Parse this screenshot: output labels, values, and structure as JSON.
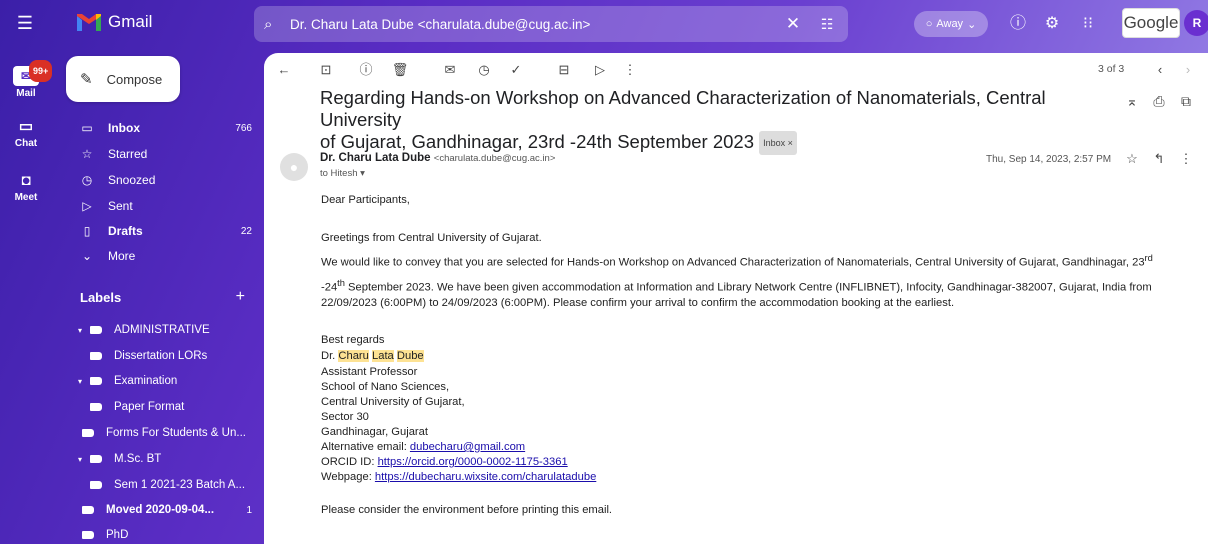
{
  "header": {
    "app_name": "Gmail",
    "search_value": "Dr. Charu Lata Dube <charulata.dube@cug.ac.in>",
    "status": "Away",
    "brand": "Google",
    "avatar_initial": "R"
  },
  "rail": {
    "mail_badge": "99+",
    "mail_label": "Mail",
    "chat_label": "Chat",
    "meet_label": "Meet"
  },
  "sidebar": {
    "compose": "Compose",
    "nav": [
      {
        "label": "Inbox",
        "count": "766"
      },
      {
        "label": "Starred",
        "count": ""
      },
      {
        "label": "Snoozed",
        "count": ""
      },
      {
        "label": "Sent",
        "count": ""
      },
      {
        "label": "Drafts",
        "count": "22"
      },
      {
        "label": "More",
        "count": ""
      }
    ],
    "labels_heading": "Labels",
    "labels": [
      {
        "label": "ADMINISTRATIVE",
        "count": ""
      },
      {
        "label": "Dissertation LORs",
        "count": ""
      },
      {
        "label": "Examination",
        "count": ""
      },
      {
        "label": "Paper Format",
        "count": ""
      },
      {
        "label": "Forms For Students & Un...",
        "count": ""
      },
      {
        "label": "M.Sc. BT",
        "count": ""
      },
      {
        "label": "Sem 1 2021-23 Batch A...",
        "count": ""
      },
      {
        "label": "Moved 2020-09-04...",
        "count": "1"
      },
      {
        "label": "PhD",
        "count": ""
      }
    ]
  },
  "message": {
    "pager": "3 of 3",
    "subject_line1": "Regarding Hands-on Workshop on Advanced Characterization of Nanomaterials, Central University",
    "subject_line2": "of Gujarat, Gandhinagar, 23rd -24th September 2023",
    "inbox_chip": "Inbox ×",
    "sender_name": "Dr. Charu Lata Dube",
    "sender_email": "<charulata.dube@cug.ac.in>",
    "to": "to Hitesh ▾",
    "date": "Thu, Sep 14, 2023, 2:57 PM",
    "greeting": "Dear Participants,",
    "line1": "Greetings from Central University of Gujarat.",
    "line2a": "We would like to convey that you are selected for Hands-on Workshop on Advanced Characterization of Nanomaterials, Central University of Gujarat, Gandhinagar, 23",
    "line2sup": "rd",
    "line3sup": "th",
    "line3a": "-24",
    "line3b": " September 2023. We have been given accommodation at Information and Library Network Centre (INFLIBNET), Infocity, Gandhinagar-382007, Gujarat, India from",
    "line4": "22/09/2023 (6:00PM) to 24/09/2023 (6:00PM). Please confirm your arrival to confirm the accommodation booking at the earliest.",
    "regards": "Best regards",
    "sig_dr": "Dr. ",
    "sig_charu": "Charu",
    "sig_lata": "Lata",
    "sig_dube": "Dube",
    "sig_title": "Assistant Professor",
    "sig_school": "School of Nano Sciences,",
    "sig_univ": "Central University of Gujarat,",
    "sig_sector": "Sector 30",
    "sig_city": "Gandhinagar, Gujarat",
    "alt_email_label": " Alternative email: ",
    "alt_email": "dubecharu@gmail.com",
    "orcid_label": "ORCID ID: ",
    "orcid": "https://orcid.org/0000-0002-1175-3361",
    "webpage_label": "Webpage: ",
    "webpage": "https://dubecharu.wixsite.com/charulatadube",
    "footer": "Please consider the environment before printing this email."
  }
}
